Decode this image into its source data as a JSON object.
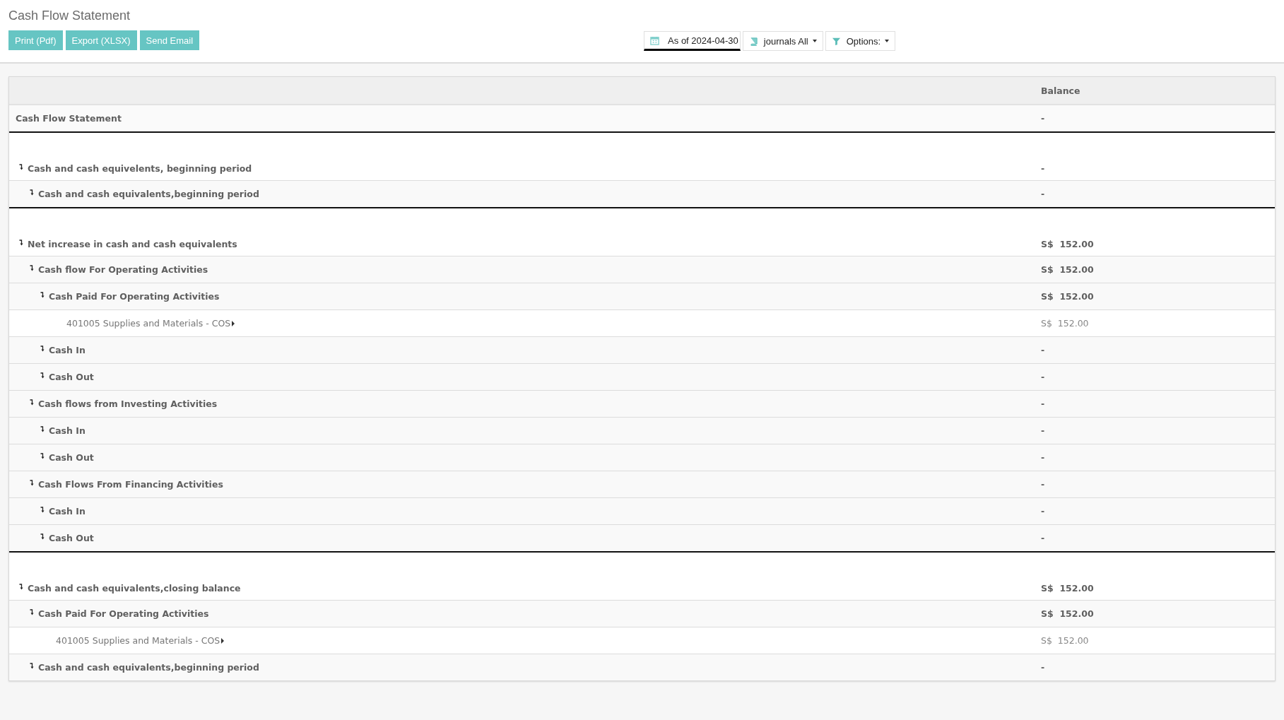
{
  "page_title": "Cash Flow Statement",
  "actions": [
    {
      "label": "Print (Pdf)"
    },
    {
      "label": "Export (XLSX)"
    },
    {
      "label": "Send Email"
    }
  ],
  "filters": [
    {
      "kind": "date",
      "label": "As of 2024-04-30"
    },
    {
      "kind": "journals",
      "label": "journals All"
    },
    {
      "kind": "options",
      "label": "Options:"
    }
  ],
  "table": {
    "columns": [
      "Balance"
    ],
    "title_row": {
      "name": "Cash Flow Statement",
      "balance": "-"
    },
    "sections": [
      {
        "kind": "group",
        "name": "Cash and cash equivelents, beginning period",
        "balance": "-",
        "children": [
          {
            "kind": "group",
            "name": "Cash and cash equivalents,beginning period",
            "balance": "-"
          }
        ]
      },
      {
        "kind": "group",
        "name": "Net increase in cash and cash equivalents",
        "balance": "S$  152.00",
        "children": [
          {
            "kind": "group",
            "name": "Cash flow For Operating Activities",
            "balance": "S$  152.00",
            "children": [
              {
                "kind": "group",
                "name": "Cash Paid For Operating Activities",
                "balance": "S$  152.00",
                "children": [
                  {
                    "kind": "account",
                    "name": "401005 Supplies and Materials - COS",
                    "balance": "S$  152.00"
                  }
                ]
              },
              {
                "kind": "group",
                "name": "Cash In",
                "balance": "-"
              },
              {
                "kind": "group",
                "name": "Cash Out",
                "balance": "-"
              }
            ]
          },
          {
            "kind": "group",
            "name": "Cash flows from Investing Activities",
            "balance": "-",
            "children": [
              {
                "kind": "group",
                "name": "Cash In",
                "balance": "-"
              },
              {
                "kind": "group",
                "name": "Cash Out",
                "balance": "-"
              }
            ]
          },
          {
            "kind": "group",
            "name": "Cash Flows From Financing Activities",
            "balance": "-",
            "children": [
              {
                "kind": "group",
                "name": "Cash In",
                "balance": "-"
              },
              {
                "kind": "group",
                "name": "Cash Out",
                "balance": "-"
              }
            ]
          }
        ]
      },
      {
        "kind": "group",
        "name": "Cash and cash equivalents,closing balance",
        "balance": "S$  152.00",
        "children": [
          {
            "kind": "group",
            "name": "Cash Paid For Operating Activities",
            "balance": "S$  152.00",
            "children": [
              {
                "kind": "account",
                "name": "401005 Supplies and Materials - COS",
                "balance": "S$  152.00"
              }
            ]
          },
          {
            "kind": "group",
            "name": "Cash and cash equivalents,beginning period",
            "balance": "-"
          }
        ]
      }
    ]
  }
}
